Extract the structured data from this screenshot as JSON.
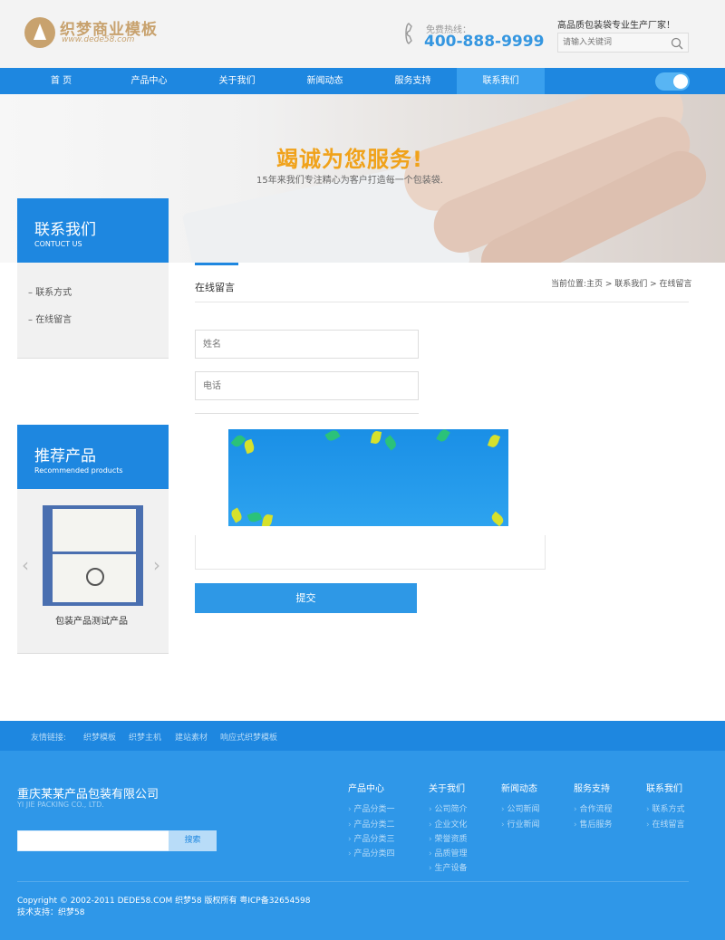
{
  "header": {
    "logo_title": "织梦商业模板",
    "logo_url": "www.dede58.com",
    "hotline_label": "免费热线：",
    "hotline_number": "400-888-9999",
    "slogan": "高品质包装袋专业生产厂家！",
    "search_placeholder": "请输入关键词"
  },
  "nav": {
    "items": [
      "首 页",
      "产品中心",
      "关于我们",
      "新闻动态",
      "服务支持",
      "联系我们"
    ],
    "active_index": 5
  },
  "banner": {
    "title": "竭诚为您服务!",
    "subtitle": "15年来我们专注精心为客户打造每一个包装袋."
  },
  "sidebar": {
    "title": "联系我们",
    "subtitle": "CONTUCT US",
    "items": [
      "联系方式",
      "在线留言"
    ]
  },
  "recommend": {
    "title": "推荐产品",
    "subtitle": "Recommended products",
    "product_name": "包装产品测试产品"
  },
  "main": {
    "title": "在线留言",
    "breadcrumb": "当前位置:主页 > 联系我们 > 在线留言",
    "name_placeholder": "姓名",
    "phone_placeholder": "电话",
    "submit_label": "提交"
  },
  "links": {
    "label": "友情链接:",
    "items": [
      "织梦模板",
      "织梦主机",
      "建站素材",
      "响应式织梦模板"
    ]
  },
  "footer": {
    "company": "重庆某某产品包装有限公司",
    "company_en": "YI JIE PACKING CO., LTD.",
    "search_button": "搜索",
    "columns": [
      {
        "title": "产品中心",
        "items": [
          "产品分类一",
          "产品分类二",
          "产品分类三",
          "产品分类四"
        ]
      },
      {
        "title": "关于我们",
        "items": [
          "公司简介",
          "企业文化",
          "荣誉资质",
          "品质管理",
          "生产设备"
        ]
      },
      {
        "title": "新闻动态",
        "items": [
          "公司新闻",
          "行业新闻"
        ]
      },
      {
        "title": "服务支持",
        "items": [
          "合作流程",
          "售后服务"
        ]
      },
      {
        "title": "联系我们",
        "items": [
          "联系方式",
          "在线留言"
        ]
      }
    ],
    "copyright": "Copyright © 2002-2011 DEDE58.COM 织梦58 版权所有 粤ICP备32654598",
    "tech": "技术支持：织梦58"
  },
  "colors": {
    "primary_blue": "#1e87e0",
    "accent_orange": "#f0a21a",
    "logo_gold": "#c8a26e"
  }
}
